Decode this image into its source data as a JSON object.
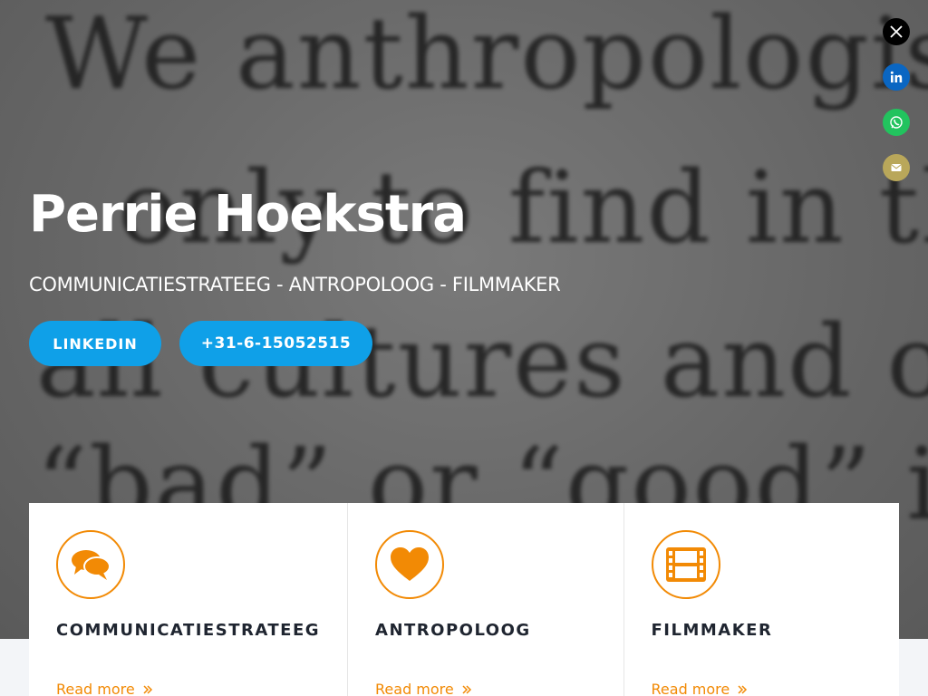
{
  "hero": {
    "title": "Perrie Hoekstra",
    "subtitle": "COMMUNICATIESTRATEEG - ANTROPOLOOG - FILMMAKER",
    "background_text": [
      "We anthropologists",
      "only to find in the",
      "all cultures and o",
      "“bad” or “good” i"
    ],
    "buttons": {
      "linkedin": "LINKEDIN",
      "phone": "+31-6-15052515"
    }
  },
  "social": [
    {
      "name": "x",
      "icon": "x-icon",
      "color": "#000000"
    },
    {
      "name": "linkedin",
      "icon": "linkedin-icon",
      "color": "#0a66c2"
    },
    {
      "name": "whatsapp",
      "icon": "whatsapp-icon",
      "color": "#22c35e"
    },
    {
      "name": "email",
      "icon": "mail-icon",
      "color": "#b9a75a"
    }
  ],
  "cards": [
    {
      "title": "COMMUNICATIESTRATEEG",
      "link": "Read more",
      "icon": "chat-bubbles-icon"
    },
    {
      "title": "ANTROPOLOOG",
      "link": "Read more",
      "icon": "heart-icon"
    },
    {
      "title": "FILMMAKER",
      "link": "Read more",
      "icon": "film-icon"
    }
  ],
  "colors": {
    "accent": "#f28a05",
    "button": "#0fa0e8",
    "title_text": "#1f2530"
  }
}
